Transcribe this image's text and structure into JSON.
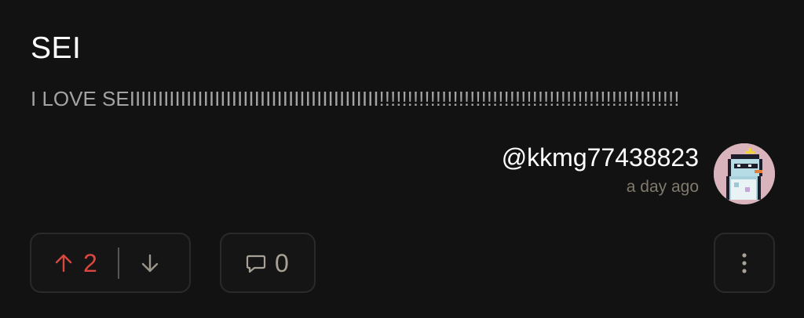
{
  "post": {
    "title": "SEI",
    "body": "I LOVE SEIIIIIIIIIIIIIIIIIIIIIIIIIIIIIIIIIIIIIIIIIIII!!!!!!!!!!!!!!!!!!!!!!!!!!!!!!!!!!!!!!!!!!!!!!!!!!!!!"
  },
  "author": {
    "username": "@kkmg77438823",
    "posted_ago": "a day ago"
  },
  "actions": {
    "upvote_icon": "arrow-up-icon",
    "score": "2",
    "downvote_icon": "arrow-down-icon",
    "comment_icon": "comment-bubble-icon",
    "comment_count": "0",
    "more_icon": "vertical-ellipsis-icon"
  },
  "colors": {
    "background": "#121212",
    "upvote_accent": "#d9473f",
    "muted_text": "#a3a3a3",
    "timestamp": "#7f7a6c",
    "button_border": "#2a2a2a"
  }
}
